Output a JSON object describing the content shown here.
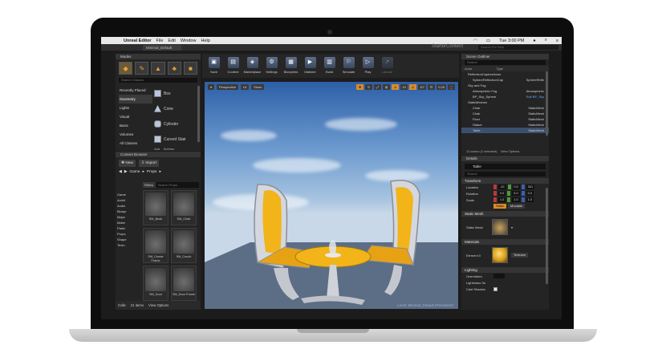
{
  "menubar": {
    "apple": "",
    "app": "Unreal Editor",
    "items": [
      "File",
      "Edit",
      "Window",
      "Help"
    ],
    "clock": "Tue 3:00 PM"
  },
  "titlebar": {
    "tab": "Minimal_Default",
    "project": "StarterContent",
    "help_search": "Search For Help"
  },
  "modes": {
    "title": "Modes",
    "search_placeholder": "Search Classes",
    "categories": [
      "Recently Placed",
      "Geometry",
      "Lights",
      "Visual",
      "Basic",
      "Volumes",
      "All Classes"
    ],
    "shapes": [
      "Box",
      "Cone",
      "Cylinder",
      "Curved Stair"
    ],
    "footer_add": "Add",
    "footer_sub": "Subtrac"
  },
  "content_browser": {
    "title": "Content Browser",
    "new_label": "New",
    "import_label": "Import",
    "crumbs": [
      "Game",
      "Props"
    ],
    "filters_label": "Filters",
    "search_placeholder": "Search Props",
    "tree": [
      "Game",
      "Archit",
      "Audio",
      "Bluepr",
      "Maps",
      "Mater",
      "Partic",
      "Props",
      "Shape",
      "Textu"
    ],
    "assets": [
      {
        "name": "SM_Bush"
      },
      {
        "name": "SM_Chair"
      },
      {
        "name": "SM_Corner Frame"
      },
      {
        "name": "SM_Couch"
      },
      {
        "name": "SM_Door"
      },
      {
        "name": "SM_Door Frame"
      }
    ],
    "collections_label": "Colle",
    "item_count": "21 items",
    "view_options": "View Options"
  },
  "toolbar": {
    "buttons": [
      {
        "label": "Save",
        "icon": "save-icon"
      },
      {
        "label": "Content",
        "icon": "content-icon"
      },
      {
        "label": "Marketplace",
        "icon": "marketplace-icon"
      },
      {
        "label": "Settings",
        "icon": "settings-icon"
      },
      {
        "label": "Blueprints",
        "icon": "blueprints-icon"
      },
      {
        "label": "Matinee",
        "icon": "matinee-icon"
      },
      {
        "label": "Build",
        "icon": "build-icon"
      },
      {
        "label": "Simulate",
        "icon": "simulate-icon"
      },
      {
        "label": "Play",
        "icon": "play-icon"
      },
      {
        "label": "Launch",
        "icon": "launch-icon"
      }
    ]
  },
  "viewport": {
    "perspective": "Perspective",
    "lit": "Lit",
    "show": "Show",
    "snap_values": [
      "10",
      "10°",
      "0.25"
    ],
    "level_label": "Level: Minimal_Default (Persistent)"
  },
  "outliner": {
    "title": "Scene Outliner",
    "search_placeholder": "Search",
    "col_actor": "Actor",
    "col_type": "Type",
    "rows": [
      {
        "name": "ReflectionCaptureActor",
        "type": ""
      },
      {
        "name": "SphereReflectionCap",
        "type": "SphereRefle"
      },
      {
        "name": "Sky and Fog",
        "type": ""
      },
      {
        "name": "Atmospheric Fog",
        "type": "Atmospheric"
      },
      {
        "name": "BP_Sky_Sphere",
        "type": "Edit BP_Sky"
      },
      {
        "name": "StaticMeshes",
        "type": ""
      },
      {
        "name": "Chair",
        "type": "StaticMesh"
      },
      {
        "name": "Chair",
        "type": "StaticMesh"
      },
      {
        "name": "Floor",
        "type": "StaticMesh"
      },
      {
        "name": "Statue",
        "type": "StaticMesh"
      },
      {
        "name": "Table",
        "type": "StaticMesh"
      }
    ],
    "footer": "13 actors (1 selected)",
    "view_options": "View Options"
  },
  "details": {
    "title": "Details",
    "object_name": "Table",
    "search_placeholder": "Search",
    "transform_label": "Transform",
    "location_label": "Location",
    "rotation_label": "Rotation",
    "scale_label": "Scale",
    "location": [
      "-10",
      "0.0",
      "321"
    ],
    "rotation": [
      "0.0",
      "0.0",
      "0.0"
    ],
    "scale": [
      "1.0",
      "1.0",
      "1.0"
    ],
    "mobility": [
      "Static",
      "Movable"
    ],
    "static_mesh_label": "Static Mesh",
    "static_mesh_field": "Static Mesh",
    "materials_label": "Materials",
    "element_label": "Element 0",
    "textures_label": "Textures",
    "lighting_label": "Lighting",
    "lighting_rows": [
      "Overridden",
      "Lightmass Se",
      "Cast Shadow"
    ]
  }
}
